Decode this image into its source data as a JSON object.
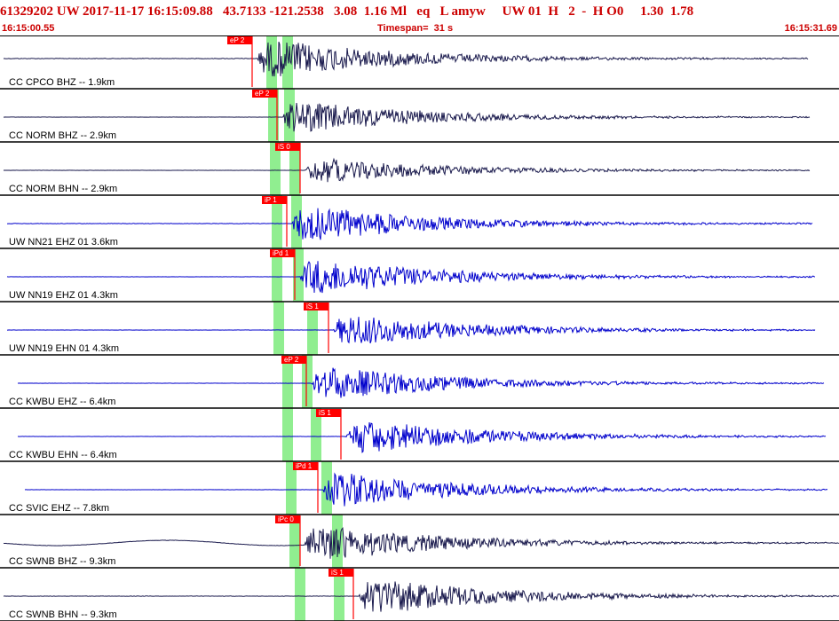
{
  "header": {
    "title": "61329202 UW 2017-11-17 16:15:09.88   43.7133 -121.2538   3.08  1.16 Ml   eq   L amyw     UW 01  H   2  -  H O0     1.30  1.78",
    "start_time": "16:15:00.55",
    "timespan": "Timespan=  31 s",
    "end_time": "16:15:31.69"
  },
  "colors": {
    "header_text": "#cc0000",
    "pick_marker": "#ff0000",
    "trace_black": "#1a1a4d",
    "trace_blue": "#0000cc",
    "window_green": "#90ee90"
  },
  "channels": [
    {
      "label": "CC CPCO BHZ -- 1.9km",
      "color": "blue-black",
      "phases": [
        "eP 2"
      ],
      "noise_level": 0.15,
      "amplitude": 0.95
    },
    {
      "label": "CC NORM BHZ -- 2.9km",
      "color": "blue-black",
      "phases": [
        "eP 2"
      ],
      "noise_level": 0.05,
      "amplitude": 0.8
    },
    {
      "label": "CC NORM BHN -- 2.9km",
      "color": "blue-black",
      "phases": [
        "iS 0"
      ],
      "noise_level": 0.05,
      "amplitude": 0.6
    },
    {
      "label": "UW NN21 EHZ 01 3.6km",
      "color": "blue",
      "phases": [
        "iP 1"
      ],
      "noise_level": 0.12,
      "amplitude": 0.9
    },
    {
      "label": "UW NN19 EHZ 01 4.3km",
      "color": "blue",
      "phases": [
        "iPd 1"
      ],
      "noise_level": 0.05,
      "amplitude": 0.9
    },
    {
      "label": "UW NN19 EHN 01 4.3km",
      "color": "blue",
      "phases": [
        "iS 1"
      ],
      "noise_level": 0.05,
      "amplitude": 0.8
    },
    {
      "label": "CC KWBU EHZ -- 6.4km",
      "color": "blue",
      "phases": [
        "eP 2"
      ],
      "noise_level": 0.05,
      "amplitude": 0.85
    },
    {
      "label": "CC KWBU EHN -- 6.4km",
      "color": "blue",
      "phases": [
        "iS 1"
      ],
      "noise_level": 0.05,
      "amplitude": 0.85
    },
    {
      "label": "CC SVIC EHZ -- 7.8km",
      "color": "blue",
      "phases": [
        "iPd 1"
      ],
      "noise_level": 0.05,
      "amplitude": 0.85
    },
    {
      "label": "CC SWNB BHZ -- 9.3km",
      "color": "blue-black",
      "phases": [
        "iPc 0"
      ],
      "noise_level": 0.1,
      "amplitude": 0.9
    },
    {
      "label": "CC SWNB BHN -- 9.3km",
      "color": "blue-black",
      "phases": [
        "iS 1"
      ],
      "noise_level": 0.1,
      "amplitude": 0.9
    }
  ]
}
